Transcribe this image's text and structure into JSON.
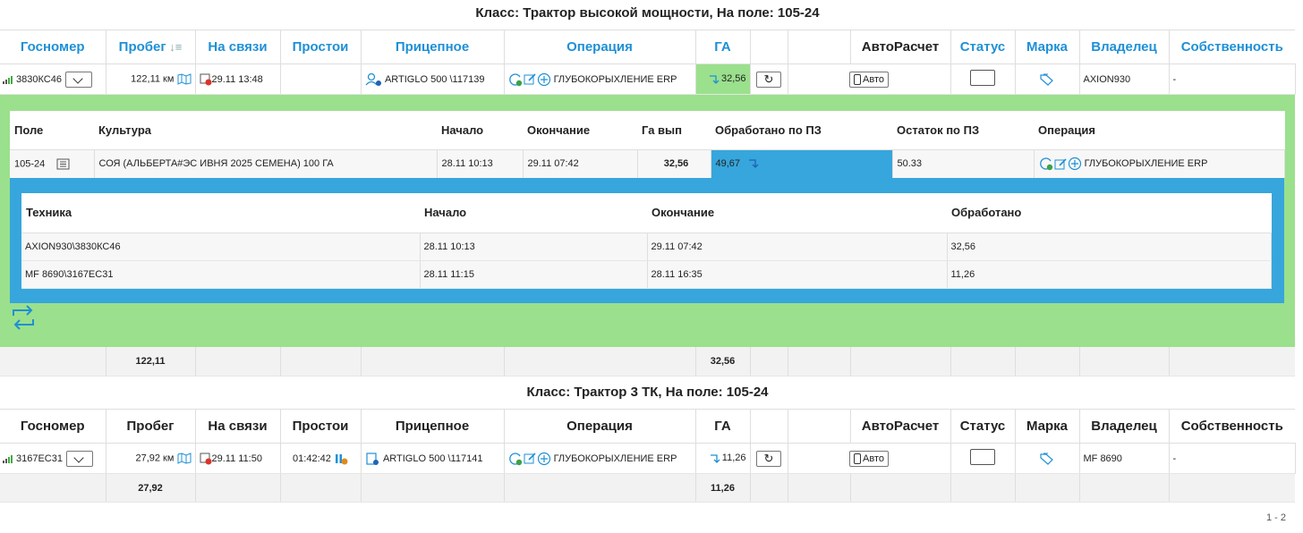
{
  "group1": {
    "title": "Класс: Трактор высокой мощности, На поле: 105-24",
    "headers": {
      "gosnomer": "Госномер",
      "probeg": "Пробег",
      "na_svyazi": "На связи",
      "prostoi": "Простои",
      "pricepnoe": "Прицепное",
      "operatsiya": "Операция",
      "ga": "ГА",
      "avtoraschet": "АвтоРасчет",
      "status": "Статус",
      "marka": "Марка",
      "vladelets": "Владелец",
      "sobstvennost": "Собственность"
    },
    "row": {
      "gosnomer": "3830КС46",
      "probeg": "122,11 км",
      "na_svyazi": "29.11 13:48",
      "prostoi": "",
      "pricepnoe": "ARTIGLO 500 \\117139",
      "operatsiya": "ГЛУБОКОРЫХЛЕНИЕ ERP",
      "ga": "32,56",
      "auto_label": "Авто",
      "marka": "AXION930",
      "vladelets": "-",
      "sobstvennost": "-"
    },
    "totals": {
      "probeg": "122,11",
      "ga": "32,56"
    },
    "detail": {
      "headers": {
        "pole": "Поле",
        "kultura": "Культура",
        "nachalo": "Начало",
        "okonchanie": "Окончание",
        "ga_vyp": "Га вып",
        "obrabotano_pz": "Обработано по ПЗ",
        "ostatok_pz": "Остаток по ПЗ",
        "operatsiya": "Операция"
      },
      "row": {
        "pole": "105-24",
        "kultura": "СОЯ (АЛЬБЕРТА#ЭС ИВНЯ 2025 СЕМЕНА) 100 ГА",
        "nachalo": "28.11 10:13",
        "okonchanie": "29.11 07:42",
        "ga_vyp": "32,56",
        "obrabotano_pz": "49,67",
        "ostatok_pz": "50.33",
        "operatsiya": "ГЛУБОКОРЫХЛЕНИЕ ERP"
      },
      "sub": {
        "headers": {
          "tehnika": "Техника",
          "nachalo": "Начало",
          "okonchanie": "Окончание",
          "obrabotano": "Обработано"
        },
        "rows": [
          {
            "tehnika": "AXION930\\3830КС46",
            "nachalo": "28.11 10:13",
            "okonchanie": "29.11 07:42",
            "obrabotano": "32,56"
          },
          {
            "tehnika": "MF 8690\\3167ЕС31",
            "nachalo": "28.11 11:15",
            "okonchanie": "28.11 16:35",
            "obrabotano": "11,26"
          }
        ]
      }
    }
  },
  "group2": {
    "title": "Класс: Трактор 3 ТК, На поле: 105-24",
    "row": {
      "gosnomer": "3167ЕС31",
      "probeg": "27,92 км",
      "na_svyazi": "29.11 11:50",
      "prostoi": "01:42:42",
      "pricepnoe": "ARTIGLO 500 \\117141",
      "operatsiya": "ГЛУБОКОРЫХЛЕНИЕ ERP",
      "ga": "11,26",
      "auto_label": "Авто",
      "marka": "MF 8690",
      "vladelets": "-",
      "sobstvennost": "-"
    },
    "totals": {
      "probeg": "27,92",
      "ga": "11,26"
    }
  },
  "pager": "1 - 2",
  "colors": {
    "link": "#1e90d6",
    "green": "#9be08c",
    "blue": "#36a6dc"
  }
}
